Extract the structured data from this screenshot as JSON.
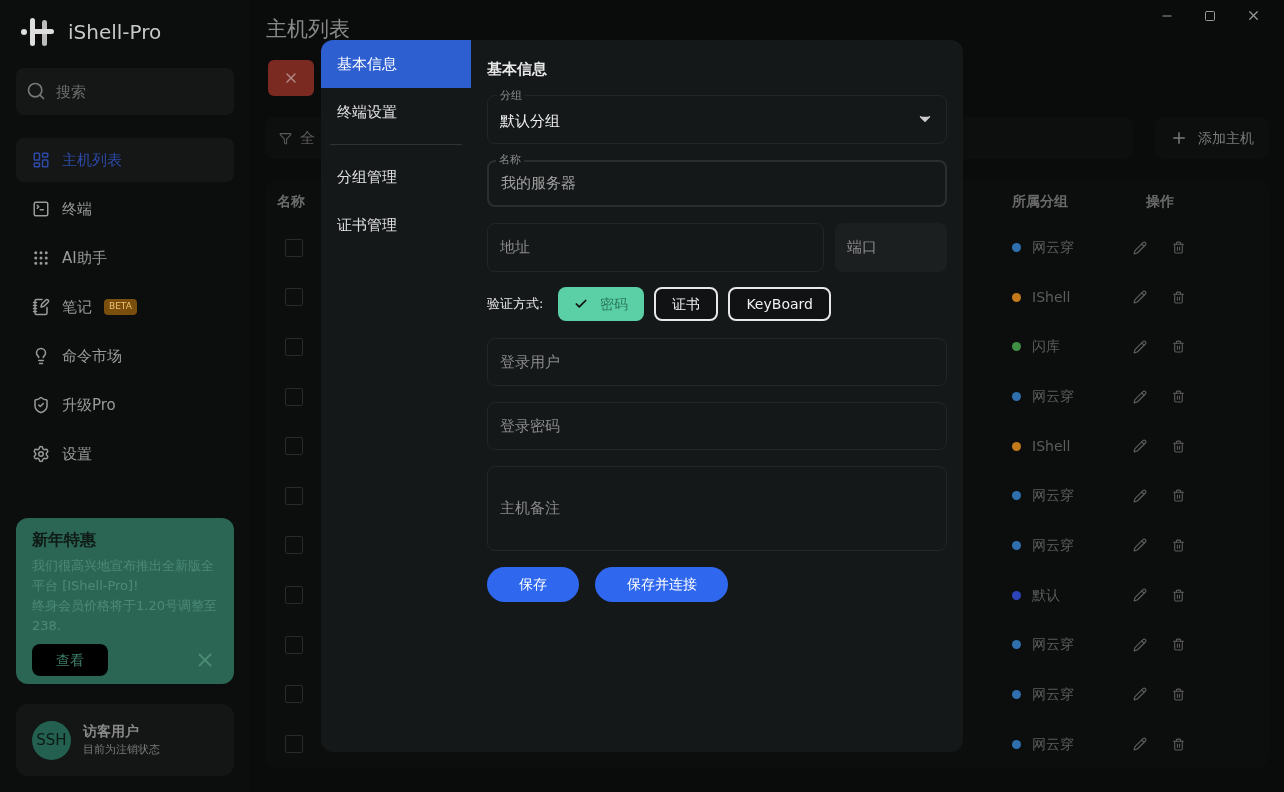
{
  "app": {
    "name": "iShell-Pro"
  },
  "sidebar": {
    "search": {
      "placeholder": "搜索"
    },
    "items": [
      {
        "kind": "hosts",
        "label": "主机列表",
        "selected": true
      },
      {
        "kind": "terminal",
        "label": "终端",
        "selected": false
      },
      {
        "kind": "ai",
        "label": "AI助手",
        "selected": false
      },
      {
        "kind": "notes",
        "label": "笔记",
        "badge": "BETA",
        "selected": false
      },
      {
        "kind": "market",
        "label": "命令市场",
        "selected": false
      },
      {
        "kind": "pro",
        "label": "升级Pro",
        "selected": false
      },
      {
        "kind": "settings",
        "label": "设置",
        "selected": false
      }
    ],
    "promo": {
      "title": "新年特惠",
      "text": "我们很高兴地宣布推出全新版全平台 [IShell-Pro]!\n终身会员价格将于1.20号调整至238.",
      "button": "查看"
    },
    "user": {
      "avatar": "SSH",
      "name": "访客用户",
      "status": "目前为注销状态"
    }
  },
  "page": {
    "title": "主机列表",
    "filter": "全",
    "add_button": "添加主机"
  },
  "table": {
    "columns": [
      {
        "label": "名称"
      },
      {
        "label": "所属分组"
      },
      {
        "label": "操作"
      }
    ],
    "rows": [
      {
        "group": "网云穿",
        "color": "#2f6fae",
        "checked": false
      },
      {
        "group": "IShell",
        "color": "#c27a1a",
        "checked": false
      },
      {
        "group": "闪库",
        "color": "#3f8f45",
        "checked": false
      },
      {
        "group": "网云穿",
        "color": "#2f6fae",
        "checked": false
      },
      {
        "group": "IShell",
        "color": "#c27a1a",
        "checked": false
      },
      {
        "group": "网云穿",
        "color": "#2f6fae",
        "checked": false
      },
      {
        "group": "网云穿",
        "color": "#2f6fae",
        "checked": false
      },
      {
        "group": "默认",
        "color": "#2d44b8",
        "checked": false
      },
      {
        "group": "网云穿",
        "color": "#2f6fae",
        "checked": false
      },
      {
        "group": "网云穿",
        "color": "#2f6fae",
        "checked": false
      },
      {
        "group": "网云穿",
        "color": "#2f6fae",
        "checked": false
      }
    ]
  },
  "dialog": {
    "nav_groups": [
      [
        {
          "label": "基本信息",
          "selected": true
        },
        {
          "label": "终端设置",
          "selected": false
        }
      ],
      [
        {
          "label": "分组管理",
          "selected": false
        },
        {
          "label": "证书管理",
          "selected": false
        }
      ]
    ],
    "heading": "基本信息",
    "group": {
      "label": "分组",
      "value": "默认分组"
    },
    "name": {
      "label": "名称",
      "placeholder": "我的服务器"
    },
    "address": {
      "placeholder": "地址"
    },
    "port": {
      "placeholder": "端口"
    },
    "auth": {
      "label": "验证方式:",
      "options": [
        {
          "label": "密码",
          "selected": true
        },
        {
          "label": "证书",
          "selected": false
        },
        {
          "label": "KeyBoard",
          "selected": false
        }
      ]
    },
    "user": {
      "placeholder": "登录用户"
    },
    "password": {
      "placeholder": "登录密码"
    },
    "notes": {
      "placeholder": "主机备注"
    },
    "buttons": [
      "保存",
      "保存并连接"
    ]
  }
}
